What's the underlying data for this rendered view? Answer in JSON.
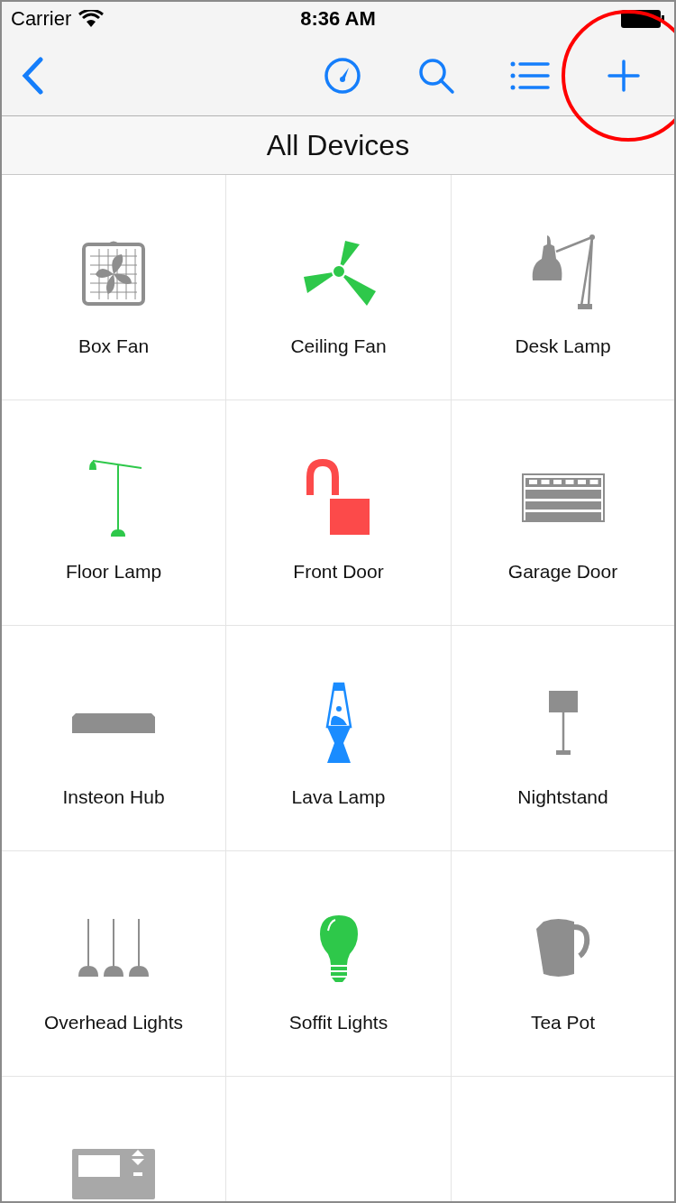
{
  "status_bar": {
    "carrier": "Carrier",
    "time": "8:36 AM"
  },
  "nav_bar": {
    "actions": [
      {
        "kind": "back"
      },
      {
        "kind": "gauge"
      },
      {
        "kind": "search"
      },
      {
        "kind": "list"
      },
      {
        "kind": "add",
        "highlighted": true
      }
    ]
  },
  "title": "All Devices",
  "devices": [
    {
      "name": "Box Fan",
      "kind": "box-fan",
      "color": "#8e8e8e"
    },
    {
      "name": "Ceiling Fan",
      "kind": "ceiling-fan",
      "color": "#2ec84a"
    },
    {
      "name": "Desk Lamp",
      "kind": "desk-lamp",
      "color": "#8e8e8e"
    },
    {
      "name": "Floor Lamp",
      "kind": "floor-lamp",
      "color": "#2ec84a"
    },
    {
      "name": "Front Door",
      "kind": "lock",
      "color": "#fc4a4a"
    },
    {
      "name": "Garage Door",
      "kind": "garage",
      "color": "#8e8e8e"
    },
    {
      "name": "Insteon Hub",
      "kind": "hub",
      "color": "#8e8e8e"
    },
    {
      "name": "Lava Lamp",
      "kind": "lava-lamp",
      "color": "#1a8cff"
    },
    {
      "name": "Nightstand",
      "kind": "nightstand",
      "color": "#8e8e8e"
    },
    {
      "name": "Overhead Lights",
      "kind": "pendants",
      "color": "#8e8e8e"
    },
    {
      "name": "Soffit Lights",
      "kind": "bulb",
      "color": "#2ec84a"
    },
    {
      "name": "Tea Pot",
      "kind": "kettle",
      "color": "#8e8e8e"
    },
    {
      "kind": "thermostat",
      "color": "#a8a8a8"
    },
    {
      "kind": "empty"
    },
    {
      "kind": "empty"
    }
  ]
}
